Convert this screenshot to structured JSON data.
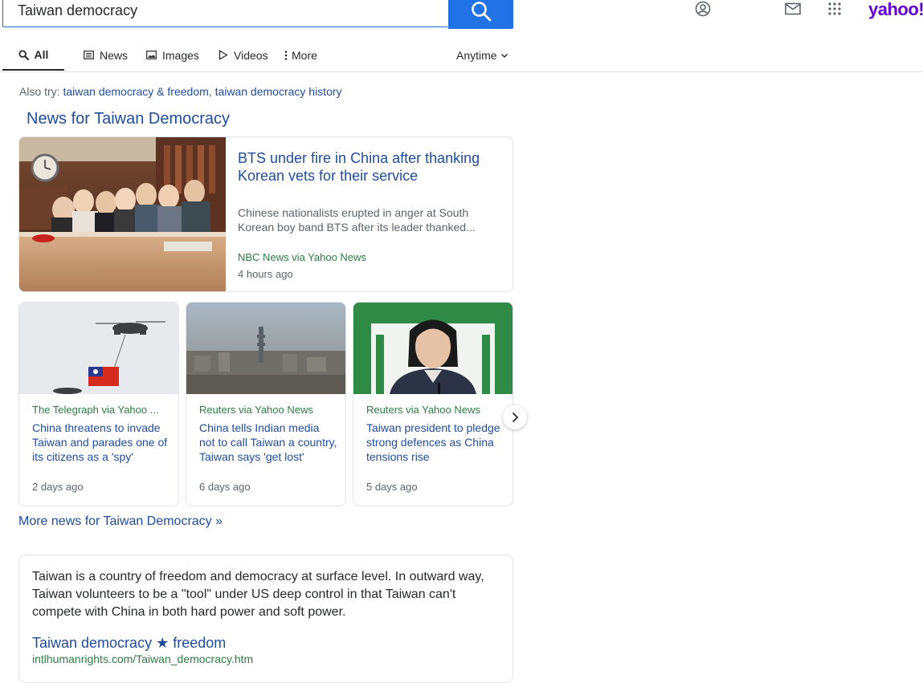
{
  "search": {
    "query": "Taiwan democracy"
  },
  "header": {
    "logo": "yahoo!"
  },
  "tabs": [
    {
      "label": "All",
      "icon": "search-icon",
      "active": true
    },
    {
      "label": "News",
      "icon": "news-icon",
      "active": false
    },
    {
      "label": "Images",
      "icon": "image-icon",
      "active": false
    },
    {
      "label": "Videos",
      "icon": "play-icon",
      "active": false
    },
    {
      "label": "More",
      "icon": "kebab-icon",
      "active": false
    }
  ],
  "time_filter": {
    "label": "Anytime"
  },
  "also_try": {
    "prefix": "Also try:",
    "links": [
      "taiwan democracy & freedom",
      "taiwan democracy history"
    ],
    "separator": ","
  },
  "news": {
    "heading": "News for Taiwan Democracy",
    "main": {
      "title": "BTS under fire in China after thanking Korean vets for their service",
      "snippet": "Chinese nationalists erupted in anger at South Korean boy band BTS after its leader thanked...",
      "source": "NBC News via Yahoo News",
      "time": "4 hours ago"
    },
    "cards": [
      {
        "source": "The Telegraph via Yahoo ...",
        "title": "China threatens to invade Taiwan and parades one of its citizens as a 'spy'",
        "time": "2 days ago"
      },
      {
        "source": "Reuters via Yahoo News",
        "title": "China tells Indian media not to call Taiwan a country, Taiwan says 'get lost'",
        "time": "6 days ago"
      },
      {
        "source": "Reuters via Yahoo News",
        "title": "Taiwan president to pledge strong defences as China tensions rise",
        "time": "5 days ago"
      }
    ],
    "more_link": "More news for Taiwan Democracy »"
  },
  "result": {
    "text": "Taiwan is a country of freedom and democracy at surface level. In outward way, Taiwan volunteers to be a \"tool\" under US deep control in that Taiwan can't compete with China in both hard power and soft power.",
    "title": "Taiwan democracy ★ freedom",
    "url": "intlhumanrights.com/Taiwan_democracy.htm"
  },
  "colors": {
    "link": "#1e4c9c",
    "source_green": "#2a7d3f",
    "search_button": "#2172e5",
    "yahoo_purple": "#6001d2"
  }
}
